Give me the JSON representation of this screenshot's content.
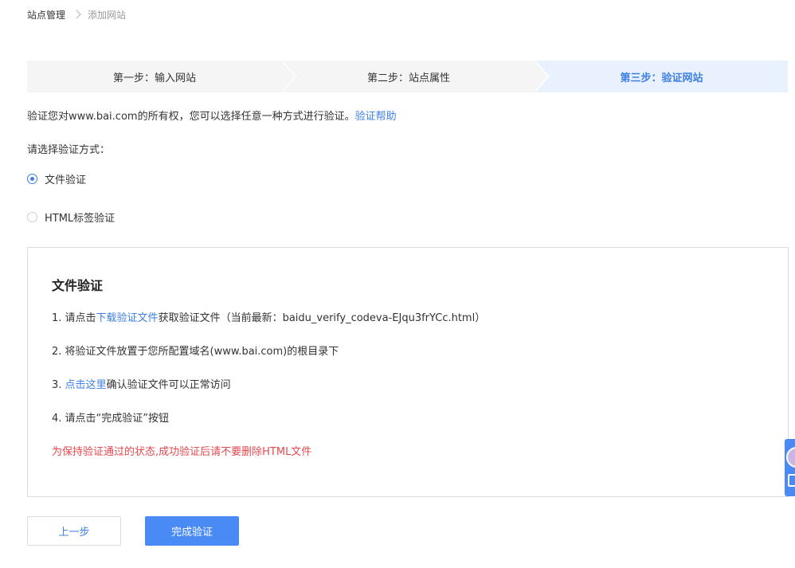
{
  "breadcrumb": {
    "root": "站点管理",
    "current": "添加网站"
  },
  "steps": [
    {
      "label": "第一步：输入网站",
      "active": false
    },
    {
      "label": "第二步：站点属性",
      "active": false
    },
    {
      "label": "第三步：验证网站",
      "active": true
    }
  ],
  "intro": {
    "text": "验证您对www.bai.com的所有权，您可以选择任意一种方式进行验证。",
    "help_link": "验证帮助"
  },
  "choose_label": "请选择验证方式：",
  "methods": [
    {
      "label": "文件验证",
      "selected": true
    },
    {
      "label": "HTML标签验证",
      "selected": false
    }
  ],
  "panel": {
    "title": "文件验证",
    "step1_prefix": "1.  请点击",
    "step1_link": "下载验证文件",
    "step1_suffix": "获取验证文件（当前最新：baidu_verify_codeva-EJqu3frYCc.html）",
    "step2": "2.  将验证文件放置于您所配置域名(www.bai.com)的根目录下",
    "step3_prefix": "3.  ",
    "step3_link": "点击这里",
    "step3_suffix": "确认验证文件可以正常访问",
    "step4": "4.  请点击“完成验证”按钮",
    "warning": "为保持验证通过的状态,成功验证后请不要删除HTML文件"
  },
  "buttons": {
    "prev": "上一步",
    "done": "完成验证"
  },
  "colors": {
    "accent": "#3e7fe6",
    "button_primary": "#4a8af4",
    "warning": "#e5484d",
    "step_active_bg": "#e8f1fd",
    "step_bg": "#f5f5f5"
  }
}
